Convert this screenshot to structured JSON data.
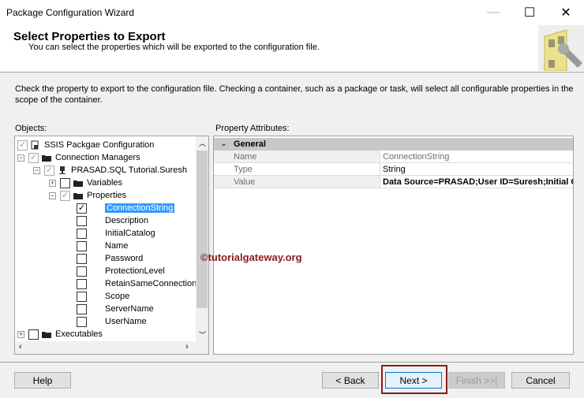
{
  "window": {
    "title": "Package Configuration Wizard",
    "minimize": "—",
    "maximize": "☐",
    "close": "✕"
  },
  "header": {
    "title": "Select Properties to Export",
    "subtitle": "You can select the properties which will be exported to the configuration file."
  },
  "description": "Check the property to export to the configuration file. Checking a container, such as a package or task, will select all configurable properties in the scope of the container.",
  "objects_label": "Objects:",
  "property_attributes_label": "Property Attributes:",
  "tree": [
    {
      "label": "SSIS Packgae Configuration",
      "level": 0,
      "checked": "gray",
      "expander": "",
      "icon": "package-icon"
    },
    {
      "label": "Connection Managers",
      "level": 1,
      "checked": "gray",
      "expander": "−",
      "icon": "folder-icon"
    },
    {
      "label": "PRASAD.SQL Tutorial.Suresh",
      "level": 2,
      "checked": "gray",
      "expander": "−",
      "icon": "connection-icon"
    },
    {
      "label": "Variables",
      "level": 3,
      "checked": "none",
      "expander": "+",
      "icon": "folder-icon"
    },
    {
      "label": "Properties",
      "level": 3,
      "checked": "gray",
      "expander": "−",
      "icon": "folder-icon"
    },
    {
      "label": "ConnectionString",
      "level": 4,
      "checked": "yes",
      "selected": true
    },
    {
      "label": "Description",
      "level": 4,
      "checked": "none"
    },
    {
      "label": "InitialCatalog",
      "level": 4,
      "checked": "none"
    },
    {
      "label": "Name",
      "level": 4,
      "checked": "none"
    },
    {
      "label": "Password",
      "level": 4,
      "checked": "none"
    },
    {
      "label": "ProtectionLevel",
      "level": 4,
      "checked": "none"
    },
    {
      "label": "RetainSameConnection",
      "level": 4,
      "checked": "none"
    },
    {
      "label": "Scope",
      "level": 4,
      "checked": "none"
    },
    {
      "label": "ServerName",
      "level": 4,
      "checked": "none"
    },
    {
      "label": "UserName",
      "level": 4,
      "checked": "none"
    },
    {
      "label": "Executables",
      "level": 0,
      "checked": "none",
      "expander": "+",
      "icon": "folder-icon"
    }
  ],
  "properties": {
    "group": "General",
    "rows": [
      {
        "name": "Name",
        "value": "ConnectionString"
      },
      {
        "name": "Type",
        "value": "String"
      },
      {
        "name": "Value",
        "value": "Data Source=PRASAD;User ID=Suresh;Initial Catalog=SQL Tutorial"
      }
    ]
  },
  "watermark": "©tutorialgateway.org",
  "buttons": {
    "help": "Help",
    "back": "< Back",
    "next": "Next >",
    "finish": "Finish >>|",
    "cancel": "Cancel"
  }
}
